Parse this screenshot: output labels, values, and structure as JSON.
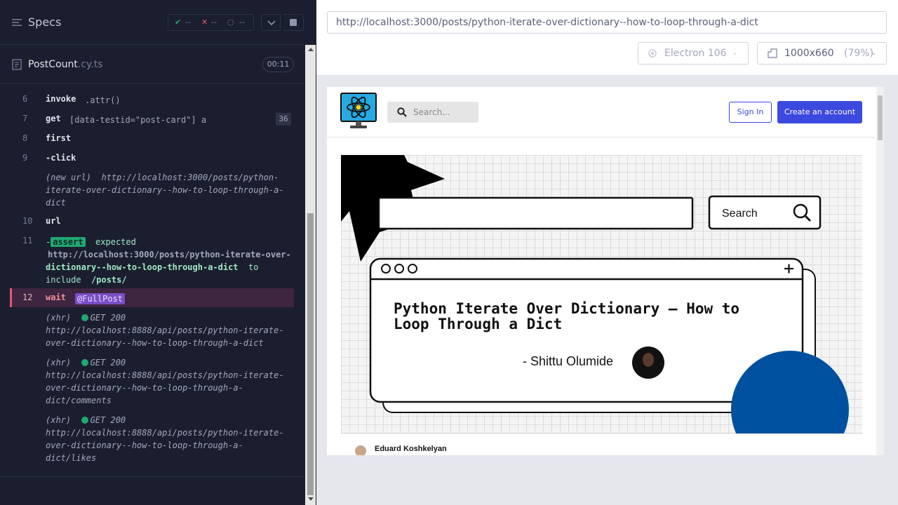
{
  "reporter": {
    "header_title": "Specs",
    "stats": {
      "passed": "--",
      "failed": "--",
      "pending": "--"
    },
    "spec_file": {
      "name": "PostCount",
      "ext": ".cy.ts",
      "duration": "00:11"
    },
    "commands": [
      {
        "num": "6",
        "name": "invoke",
        "message": ".attr()"
      },
      {
        "num": "7",
        "name": "get",
        "message": "[data-testid=\"post-card\"] a",
        "count": "36"
      },
      {
        "num": "8",
        "name": "first",
        "message": ""
      },
      {
        "num": "9",
        "name": "-click",
        "message": ""
      },
      {
        "num": "",
        "event": "(new url)",
        "message_lines": [
          "http://localhost:3000/posts/python-",
          "iterate-over-dictionary--how-to-loop-through-a-",
          "dict"
        ]
      },
      {
        "num": "10",
        "name": "url",
        "message": ""
      },
      {
        "num": "11",
        "prefix": "-",
        "tag": "assert",
        "word1": "expected",
        "line2": "http://localhost:3000/posts/python-iterate-over-",
        "line3": "dictionary--how-to-loop-through-a-dict",
        "line3_suffix": "to",
        "line4a": "include",
        "line4b": "/posts/"
      },
      {
        "num": "12",
        "name": "wait",
        "alias": "@FullPost"
      },
      {
        "event": "(xhr)",
        "status": "GET 200",
        "lines": [
          "http://localhost:8888/api/posts/python-iterate-",
          "over-dictionary--how-to-loop-through-a-dict"
        ]
      },
      {
        "event": "(xhr)",
        "status": "GET 200",
        "lines": [
          "http://localhost:8888/api/posts/python-iterate-",
          "over-dictionary--how-to-loop-through-a-",
          "dict/comments"
        ]
      },
      {
        "event": "(xhr)",
        "status": "GET 200",
        "lines": [
          "http://localhost:8888/api/posts/python-iterate-",
          "over-dictionary--how-to-loop-through-a-",
          "dict/likes"
        ]
      }
    ]
  },
  "runner": {
    "url": "http://localhost:3000/posts/python-iterate-over-dictionary--how-to-loop-through-a-dict",
    "browser": "Electron 106",
    "viewport": "1000x660",
    "zoom": "(79%)"
  },
  "site": {
    "search_placeholder": "Search...",
    "signin_label": "Sign In",
    "create_label": "Create an account",
    "cover": {
      "search_label": "Search",
      "title": "Python Iterate Over Dictionary – How to Loop Through a Dict",
      "author": "- Shittu Olumide"
    },
    "author_strip_name": "Eduard Koshkelyan"
  },
  "colors": {
    "reporter_bg": "#1b1e2e",
    "assert_green": "#1fa971",
    "alias_purple": "#7a4ec4",
    "active_row": "#3e2540",
    "primary_blue": "#3b49df",
    "cover_circle": "#0050a0"
  }
}
